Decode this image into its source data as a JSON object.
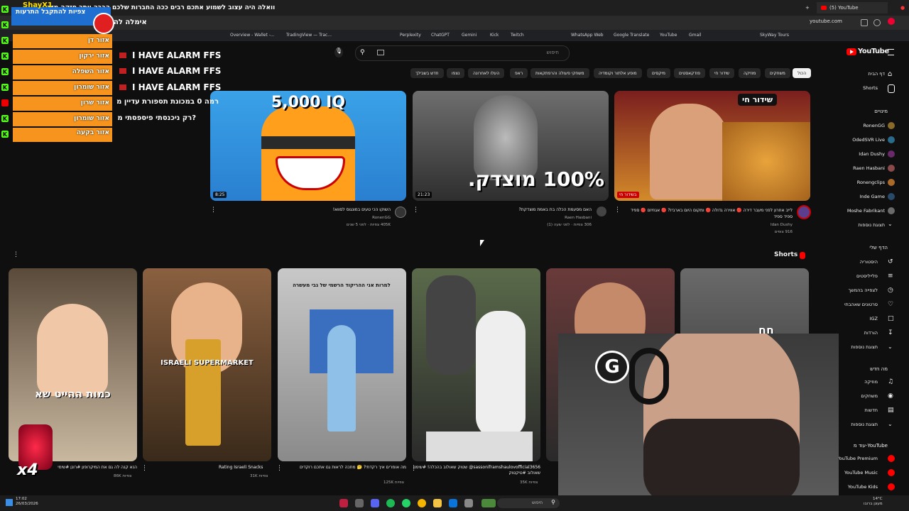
{
  "browser": {
    "tab_active": "(5) YouTube",
    "window_title": "וואלה היה עצוב לשמוע אתכם רבים ככה החברות שלכם הרבה יותר חזקה מזה",
    "address": "youtube.com",
    "bookmarks": [
      "Overview - Wallet -...",
      "TradingView — Trac...",
      "Perplexity",
      "ChatGPT",
      "Gemini",
      "Kick",
      "Twitch",
      "WhatsApp Web",
      "Google Translate",
      "YouTube",
      "Gmail",
      "SkyWay Tours"
    ]
  },
  "stream_overlay": {
    "alert_badge": "צפיות להתקבל התרעות",
    "streamer": "ShayX1",
    "top_message": "אימלה לה",
    "regions": [
      "אזור דן",
      "אזור ירקון",
      "אזור השפלה",
      "אזור שומרון",
      "אזור שרון",
      "אזור שומרון",
      "אזור בקעה"
    ],
    "chat_lines": [
      "I HAVE ALARM FFS",
      "I HAVE ALARM FFS",
      "I HAVE ALARM FFS"
    ],
    "chat_sub": [
      "רמה 0 במכונת תספורת עדיין מ",
      "?רק ניכנסתי פיספסתי מ"
    ],
    "x4": "x4"
  },
  "youtube": {
    "logo": "YouTube",
    "search_placeholder": "חיפוש",
    "chips": [
      "הכול",
      "משחקים",
      "מוזיקה",
      "שידור חי",
      "פודקאסטים",
      "מיקסים",
      "מופע אלתור וקומדיה",
      "משחקי פעולה והרפתקאות",
      "ראפ",
      "העלו לאחרונה",
      "נצפו",
      "חדש בשבילך"
    ],
    "videos": [
      {
        "title": "השוקו הכי טעים במונגוס לסווא!",
        "channel": "RonenGG",
        "meta": "405K צפיות · לפני 5 שנים",
        "thumb_text": "5,000 IQ",
        "duration": "8:25"
      },
      {
        "title": "האם מסעמת הכלה בת באמת מוצדקת?",
        "channel": "Raen Hasbani",
        "meta": "306 צפיות · לפני שעה (1)",
        "thumb_text": "100% מוצדק.",
        "duration": "21:23"
      },
      {
        "title": "לייב אחרון לפני מעבר דירה 🔴 אווירה גדולה 🔴 ומקום היום בארביז? 🔴 אגוזיזם 🔴 ספיד ספיד ספיד",
        "channel": "Idan Dushy",
        "meta": "916 צופים",
        "thumb_text": "שידור חי",
        "duration": "בשידור חי"
      }
    ],
    "shorts_header": "Shorts",
    "shorts": [
      {
        "title": "הנא קנה לה גם את המיקרופון #רונן #שימי",
        "views": "86K צפיות",
        "overlay": "כמות ההייט שא"
      },
      {
        "title": "Rating Israeli Snacks",
        "views": "31K צפיות",
        "overlay": "ISRAELI SUPERMARKET"
      },
      {
        "title": "מה אומרים איך רקדתי? 🤔 מתכה לראות גם אתכם רוקדים",
        "views": "125K צפיות",
        "overlay": "למרות אני ההריקוד הרשמי של גבי מעשרה"
      },
      {
        "title": "sassoniframshaulovofficial3656@ שטוק שאולוב בהכלה! #שימון שאולוב #טיקטוק",
        "views": "35K צפיות",
        "overlay": ""
      },
      {
        "title": "",
        "views": "",
        "overlay": "חח"
      }
    ],
    "sidebar": {
      "main": [
        {
          "label": "דף הבית",
          "icon": "home-icon"
        },
        {
          "label": "Shorts",
          "icon": "shorts-icon"
        }
      ],
      "subs_header": "מינויים",
      "subscriptions": [
        "RonenGG",
        "OdedSVR Live",
        "Idan Dushy",
        "Raen Hasbani",
        "Ronengclips",
        "Inde Game",
        "Moshe Fabrikant",
        "תצוגת נוספות"
      ],
      "you_header": "הדף שלי",
      "you": [
        "היסטוריה",
        "פלייליסטים",
        "לצפייה בהמשך",
        "סרטונים שאהבתי",
        "IGZ",
        "הורדות",
        "תצוגת נוספות"
      ],
      "explore_header": "מה חדש",
      "explore": [
        "מוזיקה",
        "משחקים",
        "חדשות",
        "תצוגת נוספות"
      ],
      "more_header": "עוד מ-YouTube",
      "more": [
        "YouTube Premium",
        "YouTube Music",
        "YouTube Kids"
      ]
    }
  },
  "webcam": {
    "brand_mark": "G"
  },
  "taskbar": {
    "time": "17:02",
    "date": "26/03/2026",
    "temp": "14°C",
    "search_label": "חיפוש",
    "weather": "מעונן ברובו"
  }
}
